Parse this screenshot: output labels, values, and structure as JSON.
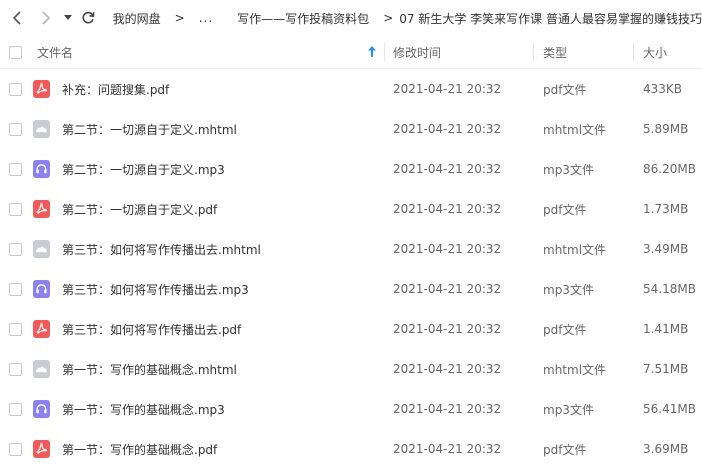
{
  "breadcrumb": {
    "root": "我的网盘",
    "ellipsis": "...",
    "parent": "写作——写作投稿资料包",
    "current": "07 新生大学 李笑来写作课 普通人最容易掌握的赚钱技巧"
  },
  "columns": {
    "name": "文件名",
    "modified": "修改时间",
    "type": "类型",
    "size": "大小"
  },
  "colors": {
    "pdf": "#f25a5a",
    "mhtml": "#c8ccd4",
    "mp3": "#8b82f0",
    "sort_arrow": "#2f8cf0"
  },
  "files": [
    {
      "name": "补充：问题搜集.pdf",
      "modified": "2021-04-21 20:32",
      "type": "pdf文件",
      "size": "433KB",
      "icon": "pdf-icon"
    },
    {
      "name": "第二节：一切源自于定义.mhtml",
      "modified": "2021-04-21 20:32",
      "type": "mhtml文件",
      "size": "5.89MB",
      "icon": "cloud-file-icon"
    },
    {
      "name": "第二节：一切源自于定义.mp3",
      "modified": "2021-04-21 20:32",
      "type": "mp3文件",
      "size": "86.20MB",
      "icon": "headphones-icon"
    },
    {
      "name": "第二节：一切源自于定义.pdf",
      "modified": "2021-04-21 20:32",
      "type": "pdf文件",
      "size": "1.73MB",
      "icon": "pdf-icon"
    },
    {
      "name": "第三节：如何将写作传播出去.mhtml",
      "modified": "2021-04-21 20:32",
      "type": "mhtml文件",
      "size": "3.49MB",
      "icon": "cloud-file-icon"
    },
    {
      "name": "第三节：如何将写作传播出去.mp3",
      "modified": "2021-04-21 20:32",
      "type": "mp3文件",
      "size": "54.18MB",
      "icon": "headphones-icon"
    },
    {
      "name": "第三节：如何将写作传播出去.pdf",
      "modified": "2021-04-21 20:32",
      "type": "pdf文件",
      "size": "1.41MB",
      "icon": "pdf-icon"
    },
    {
      "name": "第一节：写作的基础概念.mhtml",
      "modified": "2021-04-21 20:32",
      "type": "mhtml文件",
      "size": "7.51MB",
      "icon": "cloud-file-icon"
    },
    {
      "name": "第一节：写作的基础概念.mp3",
      "modified": "2021-04-21 20:32",
      "type": "mp3文件",
      "size": "56.41MB",
      "icon": "headphones-icon"
    },
    {
      "name": "第一节：写作的基础概念.pdf",
      "modified": "2021-04-21 20:32",
      "type": "pdf文件",
      "size": "3.69MB",
      "icon": "pdf-icon"
    }
  ]
}
